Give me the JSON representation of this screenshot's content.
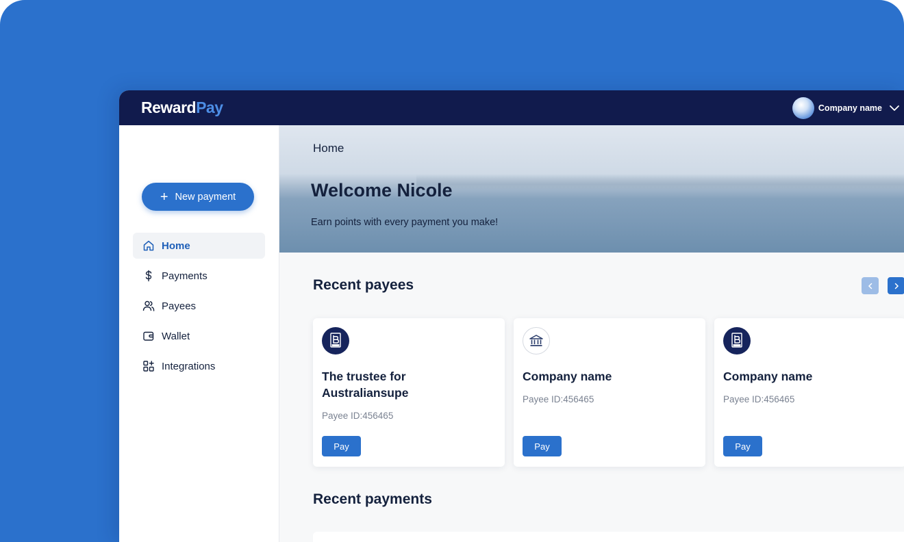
{
  "app": {
    "logo_part1": "Reward",
    "logo_part2": "Pay",
    "account_name": "Company name"
  },
  "sidebar": {
    "new_payment_label": "New payment",
    "items": [
      {
        "label": "Home",
        "icon": "home-icon",
        "active": true
      },
      {
        "label": "Payments",
        "icon": "dollar-icon",
        "active": false
      },
      {
        "label": "Payees",
        "icon": "users-icon",
        "active": false
      },
      {
        "label": "Wallet",
        "icon": "wallet-icon",
        "active": false
      },
      {
        "label": "Integrations",
        "icon": "integrations-icon",
        "active": false
      }
    ]
  },
  "hero": {
    "breadcrumb": "Home",
    "welcome": "Welcome Nicole",
    "subtitle": "Earn points with every payment you make!"
  },
  "recent_payees": {
    "title": "Recent payees",
    "cards": [
      {
        "name": "The trustee for Australiansupe",
        "payee_id": "Payee ID:456465",
        "icon": "bpay-icon",
        "pay_label": "Pay"
      },
      {
        "name": "Company name",
        "payee_id": "Payee ID:456465",
        "icon": "bank-icon",
        "pay_label": "Pay"
      },
      {
        "name": "Company name",
        "payee_id": "Payee ID:456465",
        "icon": "bpay-icon",
        "pay_label": "Pay"
      }
    ]
  },
  "recent_payments": {
    "title": "Recent payments"
  },
  "colors": {
    "accent": "#2b71cc",
    "topbar": "#111b4d",
    "text": "#14213d"
  }
}
